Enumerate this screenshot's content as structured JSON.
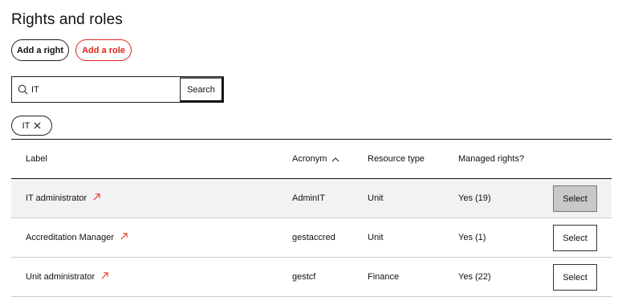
{
  "header": {
    "title": "Rights and roles"
  },
  "actions": {
    "add_right": "Add a right",
    "add_role": "Add a role"
  },
  "search": {
    "value": "IT",
    "button_label": "Search"
  },
  "filters": [
    {
      "label": "IT"
    }
  ],
  "table": {
    "columns": {
      "label": "Label",
      "acronym": "Acronym",
      "resource_type": "Resource type",
      "managed_rights": "Managed rights?"
    },
    "rows": [
      {
        "label": "IT administrator",
        "acronym": "AdminIT",
        "resource_type": "Unit",
        "managed_rights": "Yes (19)",
        "action": "Select"
      },
      {
        "label": "Accreditation Manager",
        "acronym": "gestaccred",
        "resource_type": "Unit",
        "managed_rights": "Yes (1)",
        "action": "Select"
      },
      {
        "label": "Unit administrator",
        "acronym": "gestcf",
        "resource_type": "Finance",
        "managed_rights": "Yes (22)",
        "action": "Select"
      }
    ]
  },
  "colors": {
    "accent": "#e2231a",
    "text": "#111111",
    "row_highlight": "#f2f2f2"
  }
}
